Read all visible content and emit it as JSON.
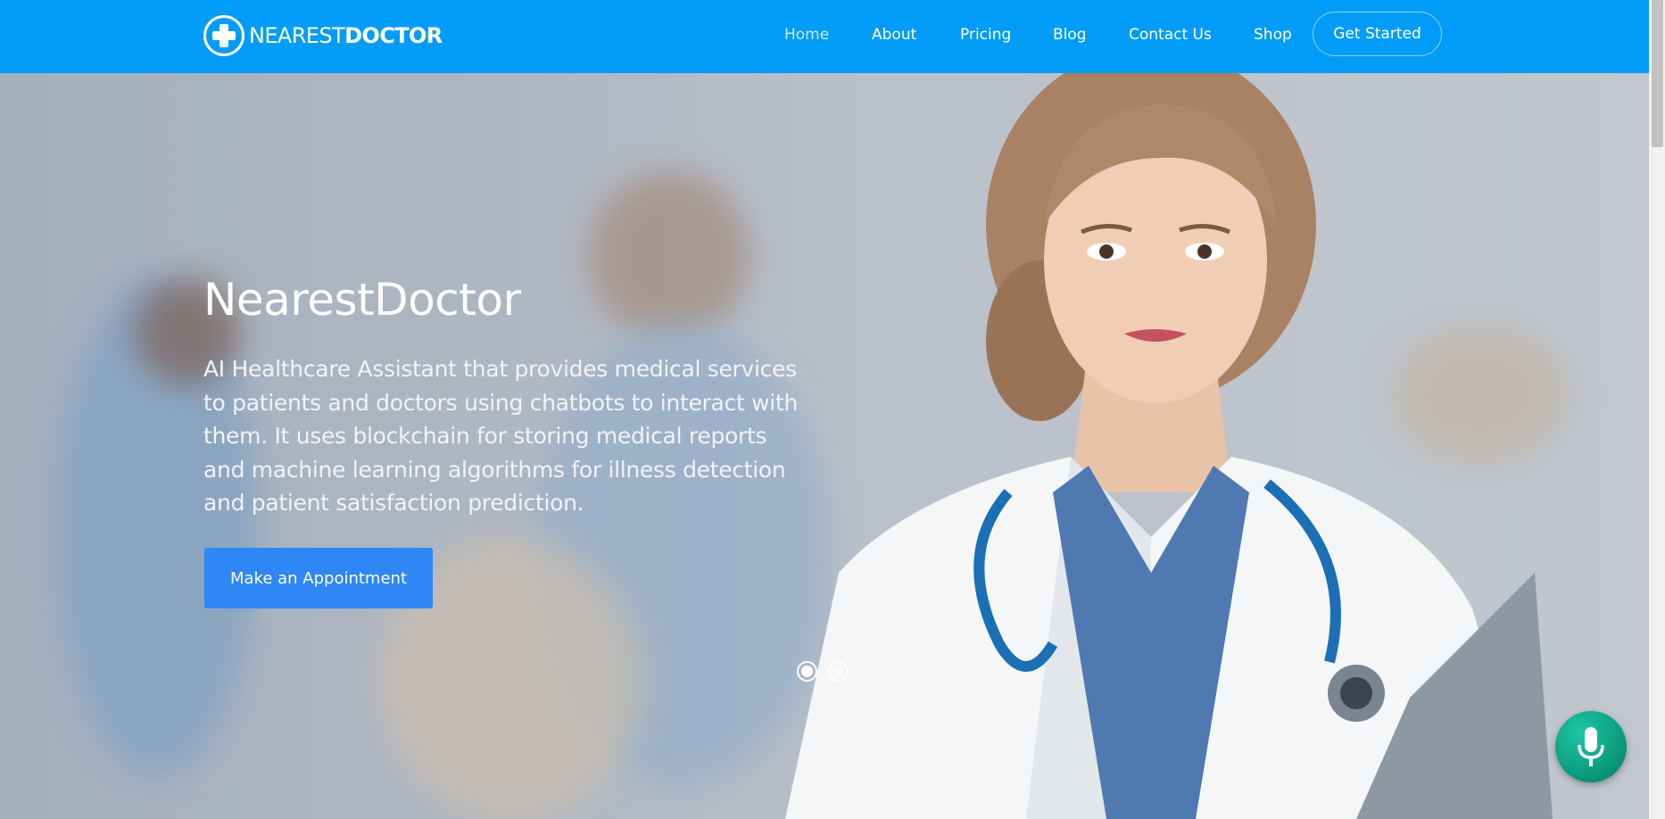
{
  "brand": {
    "light": "NEAREST",
    "bold": "DOCTOR",
    "logo_icon": "medical-cross-icon"
  },
  "nav": {
    "items": [
      {
        "label": "Home",
        "active": true
      },
      {
        "label": "About"
      },
      {
        "label": "Pricing"
      },
      {
        "label": "Blog"
      },
      {
        "label": "Contact Us"
      },
      {
        "label": "Shop"
      }
    ],
    "cta_label": "Get Started"
  },
  "hero": {
    "title": "NearestDoctor",
    "description": "AI Healthcare Assistant that provides medical services to patients and doctors using chatbots to interact with them. It uses blockchain for storing medical reports and machine learning algorithms for illness detection and patient satisfaction prediction.",
    "button_label": "Make an Appointment",
    "slides": {
      "count": 2,
      "active": 1
    }
  },
  "voice_button": {
    "icon": "microphone-icon"
  },
  "colors": {
    "header": "#009cf7",
    "cta": "#2f86f5",
    "mic": "#0c9c7e"
  }
}
